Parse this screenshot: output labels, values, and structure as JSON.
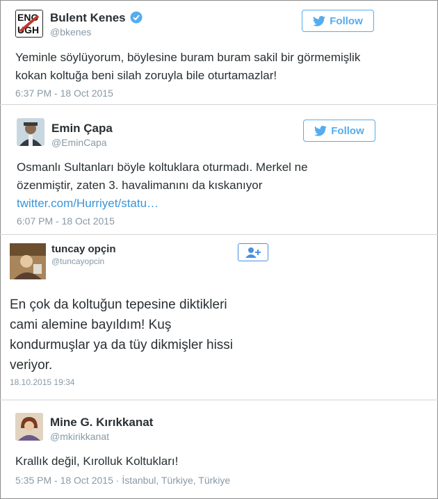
{
  "tweets": [
    {
      "name": "Bulent Kenes",
      "handle": "@bkenes",
      "verified": true,
      "follow_label": "Follow",
      "avatar_text": "ENOUGH",
      "text": "Yeminle söylüyorum, böylesine buram buram sakil bir görmemişlik kokan koltuğa beni silah zoruyla bile oturtamazlar!",
      "time": "6:37 PM - 18 Oct 2015"
    },
    {
      "name": "Emin Çapa",
      "handle": "@EminCapa",
      "follow_label": "Follow",
      "text_line1": "Osmanlı Sultanları böyle koltuklara oturmadı. Merkel ne",
      "text_line2": "özenmiştir, zaten 3. havalimanını da kıskanıyor",
      "link": "twitter.com/Hurriyet/statu…",
      "time": "6:07 PM - 18 Oct 2015"
    },
    {
      "name": "tuncay opçin",
      "handle": "@tuncayopcin",
      "text_lines": [
        "En çok da koltuğun tepesine diktikleri",
        "cami alemine bayıldım! Kuş",
        "kondurmuşlar ya da tüy dikmişler hissi",
        "veriyor."
      ],
      "time": "18.10.2015 19:34"
    },
    {
      "name": "Mine G. Kırıkkanat",
      "handle": "@mkirikkanat",
      "text": "Krallık değil, Kırolluk Koltukları!",
      "time": "5:35 PM - 18 Oct 2015",
      "location": "İstanbul, Türkiye, Türkiye"
    }
  ],
  "colors": {
    "accent": "#55acee",
    "name": "#292f33",
    "muted": "#8899a6",
    "link": "#3b94d9"
  }
}
